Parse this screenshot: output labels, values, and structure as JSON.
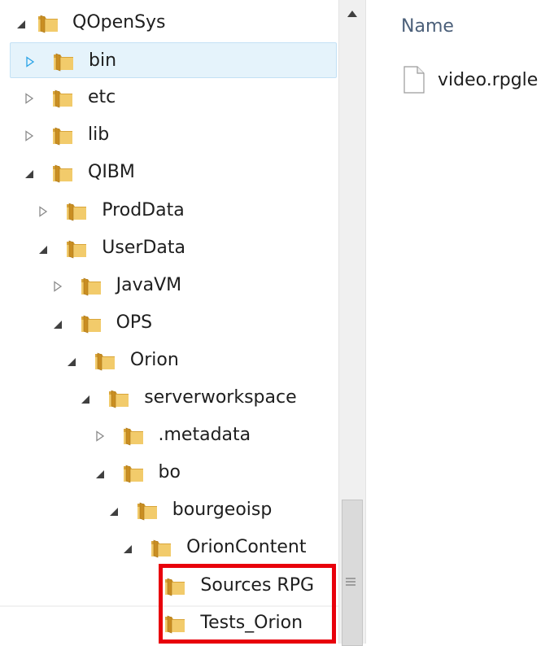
{
  "tree": [
    {
      "label": "QOpenSys",
      "state": "expanded",
      "level": 0,
      "selected": false
    },
    {
      "label": "bin",
      "state": "collapsed",
      "level": 1,
      "selected": true
    },
    {
      "label": "etc",
      "state": "collapsed",
      "level": 1,
      "selected": false
    },
    {
      "label": "lib",
      "state": "collapsed",
      "level": 1,
      "selected": false
    },
    {
      "label": "QIBM",
      "state": "expanded",
      "level": 1,
      "selected": false
    },
    {
      "label": "ProdData",
      "state": "collapsed",
      "level": 2,
      "selected": false
    },
    {
      "label": "UserData",
      "state": "expanded",
      "level": 2,
      "selected": false
    },
    {
      "label": "JavaVM",
      "state": "collapsed",
      "level": 3,
      "selected": false
    },
    {
      "label": "OPS",
      "state": "expanded",
      "level": 3,
      "selected": false
    },
    {
      "label": "Orion",
      "state": "expanded",
      "level": 4,
      "selected": false
    },
    {
      "label": "serverworkspace",
      "state": "expanded",
      "level": 5,
      "selected": false
    },
    {
      "label": ".metadata",
      "state": "collapsed",
      "level": 6,
      "selected": false
    },
    {
      "label": "bo",
      "state": "expanded",
      "level": 6,
      "selected": false
    },
    {
      "label": "bourgeoisp",
      "state": "expanded",
      "level": 7,
      "selected": false
    },
    {
      "label": "OrionContent",
      "state": "expanded",
      "level": 8,
      "selected": false
    },
    {
      "label": "Sources RPG",
      "state": "leaf",
      "level": 9,
      "selected": false
    },
    {
      "label": "Tests_Orion",
      "state": "leaf",
      "level": 9,
      "selected": false
    }
  ],
  "content": {
    "column_header": "Name",
    "files": [
      {
        "name": "video.rpgle",
        "icon": "file-icon"
      }
    ]
  },
  "colors": {
    "selected_bg": "#e5f3fb",
    "selected_border": "#c3e1f5",
    "highlight": "#e8000b",
    "folder": "#e8b84a",
    "header_text": "#4c607a"
  }
}
